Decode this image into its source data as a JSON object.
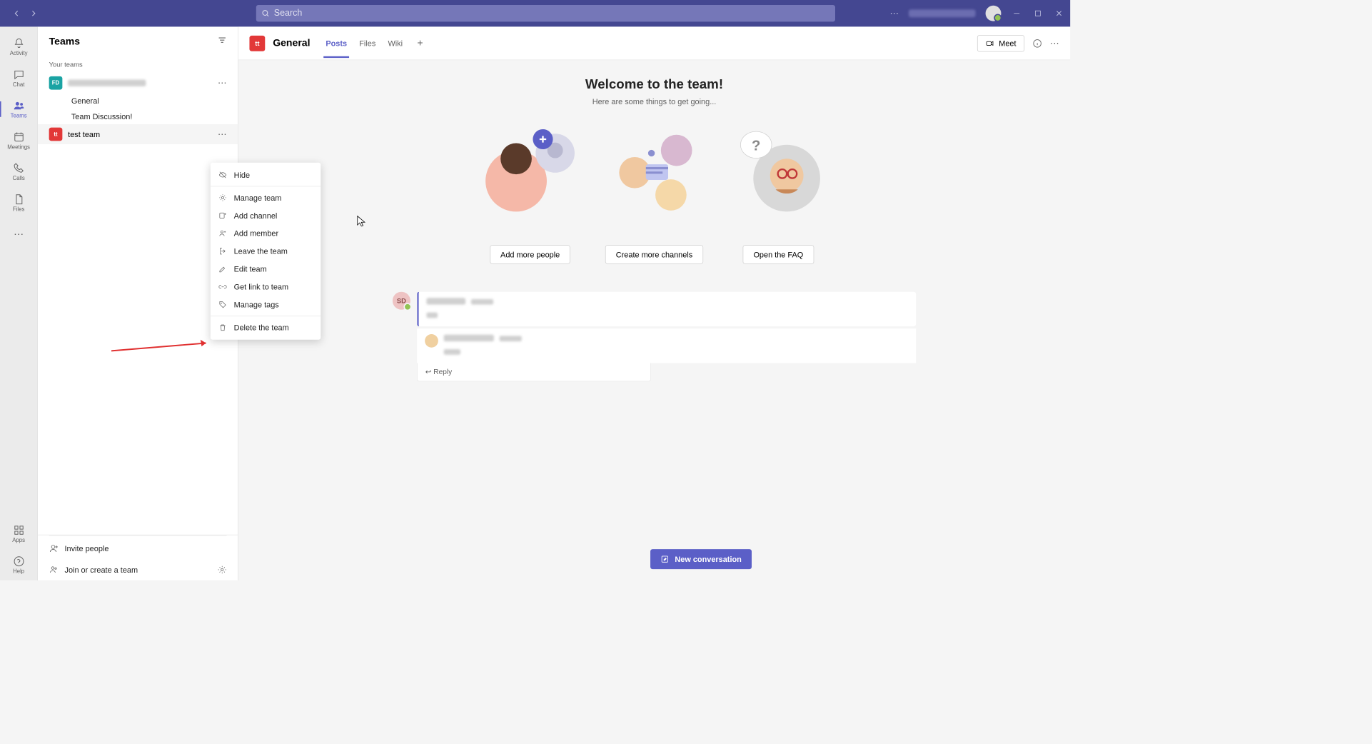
{
  "titlebar": {
    "search_placeholder": "Search"
  },
  "rail": {
    "items": [
      {
        "label": "Activity"
      },
      {
        "label": "Chat"
      },
      {
        "label": "Teams"
      },
      {
        "label": "Meetings"
      },
      {
        "label": "Calls"
      },
      {
        "label": "Files"
      }
    ],
    "apps_label": "Apps",
    "help_label": "Help"
  },
  "sidebar": {
    "title": "Teams",
    "section_label": "Your teams",
    "teams": [
      {
        "avatar_bg": "#1aa3a3",
        "avatar_text": "FD",
        "channels": [
          "General",
          "Team Discussion!"
        ]
      },
      {
        "avatar_bg": "#e23838",
        "avatar_text": "tt",
        "name": "test team"
      }
    ],
    "invite_label": "Invite people",
    "join_label": "Join or create a team"
  },
  "context_menu": {
    "items": [
      {
        "label": "Hide",
        "icon": "eye-off"
      },
      {
        "label": "Manage team",
        "icon": "gear"
      },
      {
        "label": "Add channel",
        "icon": "channel-add"
      },
      {
        "label": "Add member",
        "icon": "person-add"
      },
      {
        "label": "Leave the team",
        "icon": "leave"
      },
      {
        "label": "Edit team",
        "icon": "pencil"
      },
      {
        "label": "Get link to team",
        "icon": "link"
      },
      {
        "label": "Manage tags",
        "icon": "tag"
      },
      {
        "label": "Delete the team",
        "icon": "trash"
      }
    ]
  },
  "header": {
    "channel_avatar": "tt",
    "channel_title": "General",
    "tabs": [
      "Posts",
      "Files",
      "Wiki"
    ],
    "meet_label": "Meet"
  },
  "welcome": {
    "title": "Welcome to the team!",
    "subtitle": "Here are some things to get going...",
    "cards": [
      {
        "button": "Add more people"
      },
      {
        "button": "Create more channels"
      },
      {
        "button": "Open the FAQ"
      }
    ]
  },
  "post": {
    "avatar_initials": "SD",
    "reply_hint": "Reply"
  },
  "compose": {
    "button": "New conversation"
  }
}
